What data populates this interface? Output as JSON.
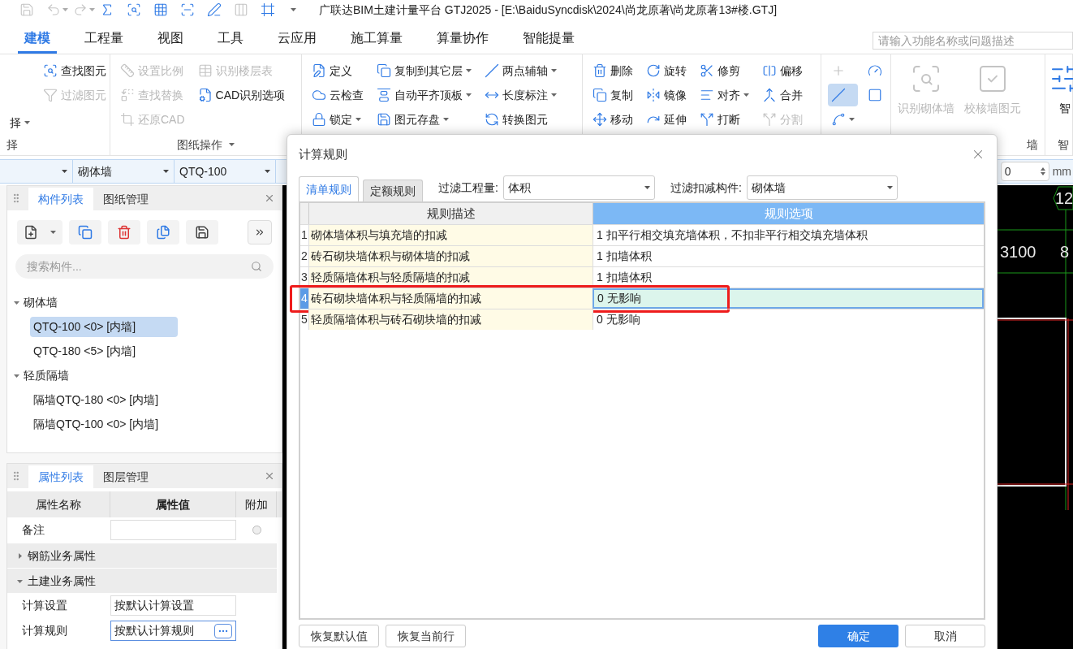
{
  "quick_access": [
    {
      "disabled": true,
      "dropdown": false
    },
    {
      "disabled": true,
      "dropdown": true
    },
    {
      "disabled": true,
      "dropdown": true
    },
    {
      "disabled": false,
      "dropdown": false
    },
    {
      "disabled": false,
      "dropdown": false
    },
    {
      "disabled": false,
      "dropdown": false
    },
    {
      "disabled": false,
      "dropdown": false
    },
    {
      "disabled": false,
      "dropdown": false
    },
    {
      "disabled": true,
      "dropdown": false
    },
    {
      "disabled": false,
      "dropdown": false
    }
  ],
  "title": "广联达BIM土建计量平台 GTJ2025 - [E:\\BaiduSyncdisk\\2024\\尚龙原著\\尚龙原著13#楼.GTJ]",
  "menu_tabs": [
    {
      "label": "建模",
      "selected": true
    },
    {
      "label": "工程量",
      "selected": false
    },
    {
      "label": "视图",
      "selected": false
    },
    {
      "label": "工具",
      "selected": false
    },
    {
      "label": "云应用",
      "selected": false
    },
    {
      "label": "施工算量",
      "selected": false
    },
    {
      "label": "算量协作",
      "selected": false
    },
    {
      "label": "智能提量",
      "selected": false
    }
  ],
  "search": {
    "placeholder": "请输入功能名称或问题描述"
  },
  "ribbon": [
    {
      "kind": "grid",
      "label": "择",
      "columns": [
        [
          null,
          null,
          {
            "label": "择",
            "dropdown": true,
            "disabled": false
          }
        ],
        [
          {
            "label": "查找图元",
            "dropdown": false,
            "disabled": false
          },
          {
            "label": "过滤图元",
            "dropdown": false,
            "disabled": true
          },
          null
        ]
      ]
    },
    {
      "kind": "grid",
      "label": "图纸操作",
      "label_dropdown": true,
      "columns": [
        [
          {
            "label": "设置比例",
            "dropdown": false,
            "disabled": true
          },
          {
            "label": "查找替换",
            "dropdown": false,
            "disabled": true
          },
          {
            "label": "还原CAD",
            "dropdown": false,
            "disabled": true
          }
        ],
        [
          {
            "label": "识别楼层表",
            "dropdown": false,
            "disabled": true
          },
          {
            "label": "CAD识别选项",
            "dropdown": false,
            "disabled": false
          },
          null
        ]
      ]
    },
    {
      "kind": "grid",
      "columns": [
        [
          {
            "label": "定义",
            "dropdown": false,
            "disabled": false
          },
          {
            "label": "云检查",
            "dropdown": false,
            "disabled": false
          },
          {
            "label": "锁定",
            "dropdown": true,
            "disabled": false
          }
        ],
        [
          {
            "label": "复制到其它层",
            "dropdown": true,
            "disabled": false
          },
          {
            "label": "自动平齐顶板",
            "dropdown": true,
            "disabled": false
          },
          {
            "label": "图元存盘",
            "dropdown": true,
            "disabled": false
          }
        ],
        [
          {
            "label": "两点辅轴",
            "dropdown": true,
            "disabled": false
          },
          {
            "label": "长度标注",
            "dropdown": true,
            "disabled": false
          },
          {
            "label": "转换图元",
            "dropdown": false,
            "disabled": false
          }
        ]
      ]
    },
    {
      "kind": "grid",
      "columns": [
        [
          {
            "label": "删除",
            "dropdown": false,
            "disabled": false
          },
          {
            "label": "复制",
            "dropdown": false,
            "disabled": false
          },
          {
            "label": "移动",
            "dropdown": false,
            "disabled": false
          }
        ],
        [
          {
            "label": "旋转",
            "dropdown": false,
            "disabled": false
          },
          {
            "label": "镜像",
            "dropdown": false,
            "disabled": false
          },
          {
            "label": "延伸",
            "dropdown": false,
            "disabled": false
          }
        ],
        [
          {
            "label": "修剪",
            "dropdown": false,
            "disabled": false
          },
          {
            "label": "对齐",
            "dropdown": true,
            "disabled": false
          },
          {
            "label": "打断",
            "dropdown": false,
            "disabled": false
          }
        ],
        [
          {
            "label": "偏移",
            "dropdown": false,
            "disabled": false
          },
          {
            "label": "合并",
            "dropdown": false,
            "disabled": false
          },
          {
            "label": "分割",
            "dropdown": false,
            "disabled": true
          }
        ]
      ]
    },
    {
      "kind": "grid",
      "columns": [
        [
          {
            "dropdown": false,
            "disabled": true,
            "selected": false
          },
          {
            "dropdown": false,
            "disabled": false,
            "selected": true
          },
          {
            "dropdown": true,
            "disabled": false,
            "selected": false
          }
        ],
        [
          {
            "dropdown": false,
            "disabled": false,
            "selected": false
          },
          {
            "dropdown": false,
            "disabled": false,
            "selected": false
          },
          null
        ]
      ]
    },
    {
      "kind": "large",
      "label": "墙",
      "buttons": [
        {
          "label": "识别砌体墙",
          "disabled": true
        },
        {
          "label": "校核墙图元",
          "disabled": true
        }
      ]
    },
    {
      "kind": "large",
      "label": "智",
      "buttons": [
        {
          "label": "智",
          "disabled": false
        }
      ]
    }
  ],
  "selector_bar": {
    "dropdowns": [
      {
        "value": "砌体墙"
      },
      {
        "value": "QTQ-100"
      }
    ],
    "spin_field": {
      "value": "0",
      "unit": "mm"
    }
  },
  "component_panel": {
    "tabs": [
      {
        "label": "构件列表",
        "selected": true
      },
      {
        "label": "图纸管理",
        "selected": false
      }
    ],
    "search_placeholder": "搜索构件...",
    "tree": [
      {
        "label": "砌体墙",
        "expanded": true,
        "children": [
          {
            "label": "QTQ-100 <0> [内墙]",
            "selected": true
          },
          {
            "label": "QTQ-180 <5> [内墙]",
            "selected": false
          }
        ]
      },
      {
        "label": "轻质隔墙",
        "expanded": true,
        "children": [
          {
            "label": "隔墙QTQ-180 <0> [内墙]",
            "selected": false
          },
          {
            "label": "隔墙QTQ-100 <0> [内墙]",
            "selected": false
          }
        ]
      }
    ]
  },
  "property_panel": {
    "tabs": [
      {
        "label": "属性列表",
        "selected": true
      },
      {
        "label": "图层管理",
        "selected": false
      }
    ],
    "columns": [
      "属性名称",
      "属性值",
      "附加"
    ],
    "rows": [
      {
        "kind": "field",
        "name": "备注",
        "attached": false
      },
      {
        "kind": "group",
        "label": "钢筋业务属性",
        "expanded": false
      },
      {
        "kind": "group",
        "label": "土建业务属性",
        "expanded": true
      },
      {
        "kind": "field",
        "name": "计算设置",
        "value": "按默认计算设置",
        "focused": false
      },
      {
        "kind": "field",
        "name": "计算规则",
        "value": "按默认计算规则",
        "focused": true
      }
    ]
  },
  "canvas": {
    "labels": [
      "12",
      "3100",
      "8"
    ]
  },
  "dialog": {
    "title": "计算规则",
    "tabs": [
      {
        "label": "清单规则",
        "selected": true
      },
      {
        "label": "定额规则",
        "selected": false
      }
    ],
    "filters": [
      {
        "label": "过滤工程量:",
        "value": "体积"
      },
      {
        "label": "过滤扣减构件:",
        "value": "砌体墙"
      }
    ],
    "table": {
      "columns": [
        {
          "label": "规则描述",
          "selected": false
        },
        {
          "label": "规则选项",
          "selected": true
        }
      ],
      "rows": [
        {
          "index": "1",
          "description": "砌体墙体积与填充墙的扣减",
          "option": "1 扣平行相交填充墙体积，不扣非平行相交填充墙体积",
          "selected": false,
          "annotated": false
        },
        {
          "index": "2",
          "description": "砖石砌块墙体积与砌体墙的扣减",
          "option": "1  扣墙体积",
          "selected": false,
          "annotated": false
        },
        {
          "index": "3",
          "description": "轻质隔墙体积与轻质隔墙的扣减",
          "option": "1  扣墙体积",
          "selected": false,
          "annotated": false
        },
        {
          "index": "4",
          "description": "砖石砌块墙体积与轻质隔墙的扣减",
          "option": "0  无影响",
          "selected": true,
          "annotated": true
        },
        {
          "index": "5",
          "description": "轻质隔墙体积与砖石砌块墙的扣减",
          "option": "0  无影响",
          "selected": false,
          "annotated": false
        }
      ]
    },
    "buttons": [
      {
        "label": "恢复默认值",
        "kind": "secondary"
      },
      {
        "label": "恢复当前行",
        "kind": "secondary"
      },
      {
        "label": "确定",
        "kind": "primary"
      },
      {
        "label": "取消",
        "kind": "secondary"
      }
    ]
  }
}
